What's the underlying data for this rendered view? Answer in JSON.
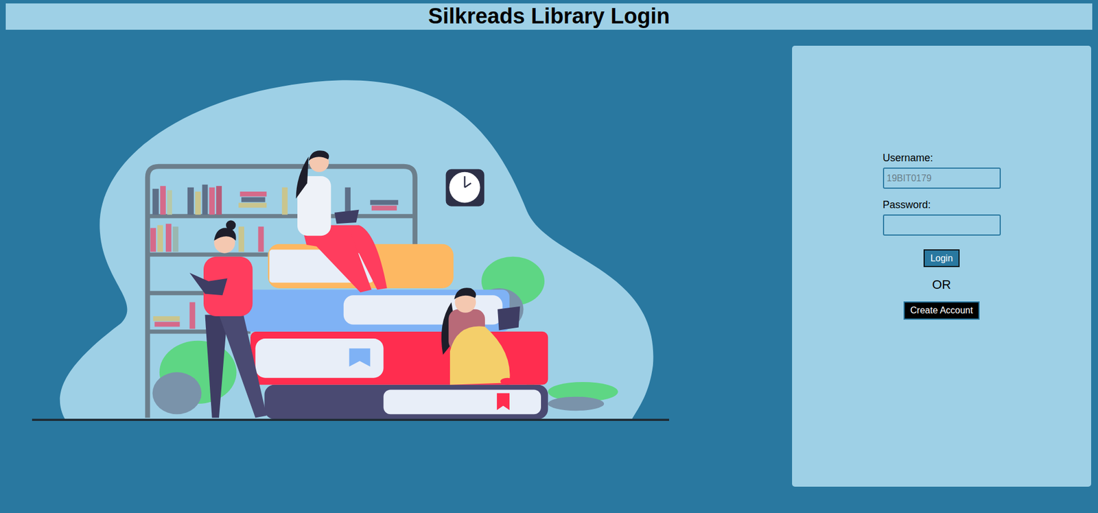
{
  "title": "Silkreads Library Login",
  "form": {
    "fields": [
      {
        "label": "Username:",
        "placeholder": "19BIT0179",
        "kind": "text"
      },
      {
        "label": "Password:",
        "kind": "password"
      }
    ],
    "login_button": "Login",
    "separator": "OR",
    "create_button": "Create Account"
  }
}
